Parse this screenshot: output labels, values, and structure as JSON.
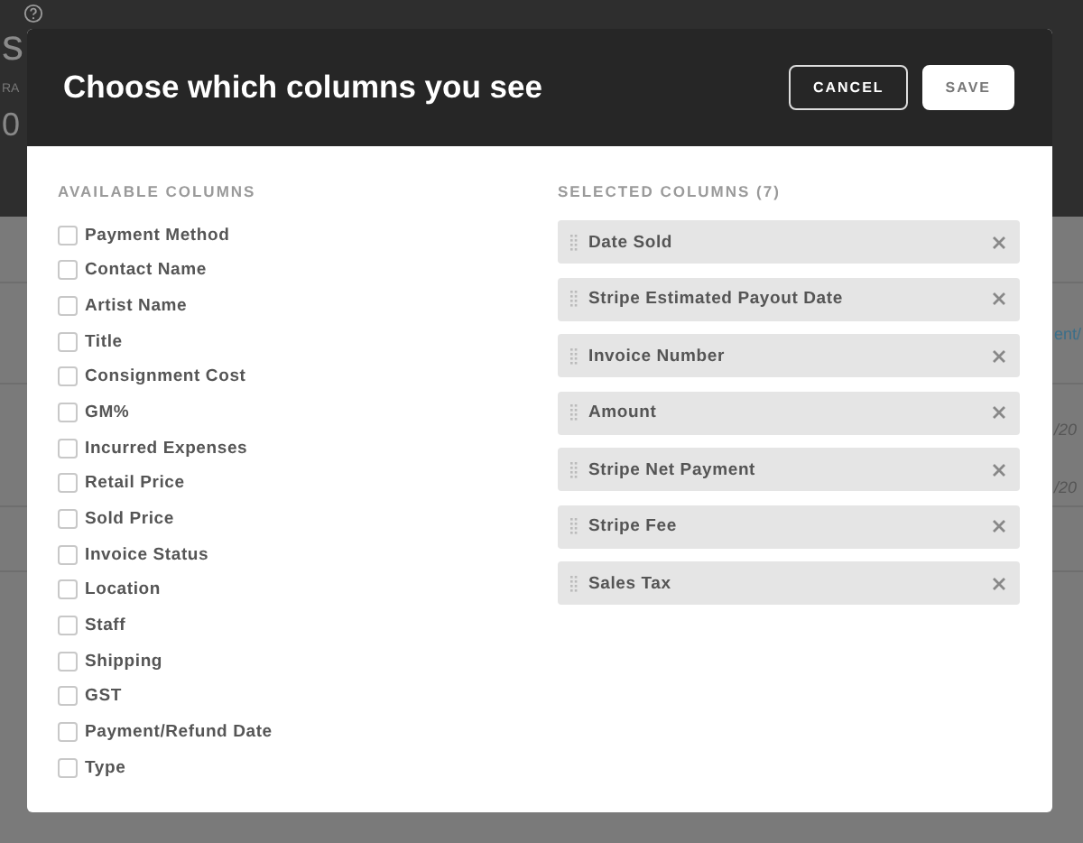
{
  "background": {
    "fragments": [
      {
        "kind": "heading",
        "text": "s"
      },
      {
        "kind": "label",
        "text": "RA"
      },
      {
        "kind": "value",
        "text": "0"
      },
      {
        "kind": "link",
        "text": "ent/"
      },
      {
        "kind": "date",
        "text": "/20"
      },
      {
        "kind": "date",
        "text": "/20"
      }
    ]
  },
  "dialog": {
    "title": "Choose which columns you see",
    "buttons": [
      {
        "label": "CANCEL",
        "kind": "secondary"
      },
      {
        "label": "SAVE",
        "kind": "primary"
      }
    ],
    "available": {
      "heading": "AVAILABLE COLUMNS",
      "columns": [
        {
          "label": "Payment Method",
          "checked": false
        },
        {
          "label": "Contact Name",
          "checked": false
        },
        {
          "label": "Artist Name",
          "checked": false
        },
        {
          "label": "Title",
          "checked": false
        },
        {
          "label": "Consignment Cost",
          "checked": false
        },
        {
          "label": "GM%",
          "checked": false
        },
        {
          "label": "Incurred Expenses",
          "checked": false
        },
        {
          "label": "Retail Price",
          "checked": false
        },
        {
          "label": "Sold Price",
          "checked": false
        },
        {
          "label": "Invoice Status",
          "checked": false
        },
        {
          "label": "Location",
          "checked": false
        },
        {
          "label": "Staff",
          "checked": false
        },
        {
          "label": "Shipping",
          "checked": false
        },
        {
          "label": "GST",
          "checked": false
        },
        {
          "label": "Payment/Refund Date",
          "checked": false
        },
        {
          "label": "Type",
          "checked": false
        }
      ]
    },
    "selected": {
      "heading": "SELECTED COLUMNS (7)",
      "columns": [
        {
          "label": "Date Sold"
        },
        {
          "label": "Stripe Estimated Payout Date"
        },
        {
          "label": "Invoice Number"
        },
        {
          "label": "Amount"
        },
        {
          "label": "Stripe Net Payment"
        },
        {
          "label": "Stripe Fee"
        },
        {
          "label": "Sales Tax"
        }
      ]
    }
  }
}
